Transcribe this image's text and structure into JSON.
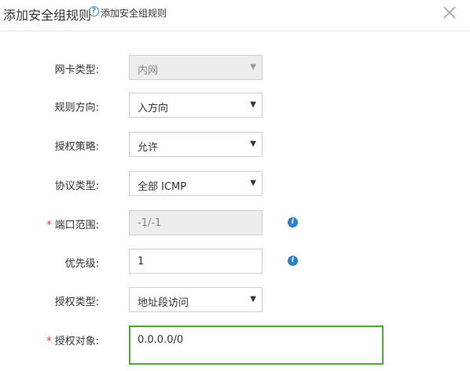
{
  "dialog": {
    "title": "添加安全组规则",
    "help_link": "添加安全组规则",
    "help_icon": "?"
  },
  "form": {
    "nic_type": {
      "label": "网卡类型:",
      "value": "内网",
      "disabled": true
    },
    "direction": {
      "label": "规则方向:",
      "value": "入方向"
    },
    "policy": {
      "label": "授权策略:",
      "value": "允许"
    },
    "protocol": {
      "label": "协议类型:",
      "value": "全部 ICMP"
    },
    "port_range": {
      "label": "端口范围:",
      "value": "-1/-1",
      "required": true,
      "disabled": true
    },
    "priority": {
      "label": "优先级:",
      "value": "1"
    },
    "auth_type": {
      "label": "授权类型:",
      "value": "地址段访问"
    },
    "auth_object": {
      "label": "授权对象:",
      "value": "0.0.0.0/0",
      "required": true
    }
  },
  "required_mark": "*",
  "info_icon_glyph": "i",
  "dropdown_arrow": "▼",
  "colors": {
    "focus_border": "#52a838",
    "info_icon": "#2c7fd1",
    "help_icon": "#2c8fce",
    "required": "#e4393c",
    "disabled_bg": "#ededed"
  }
}
